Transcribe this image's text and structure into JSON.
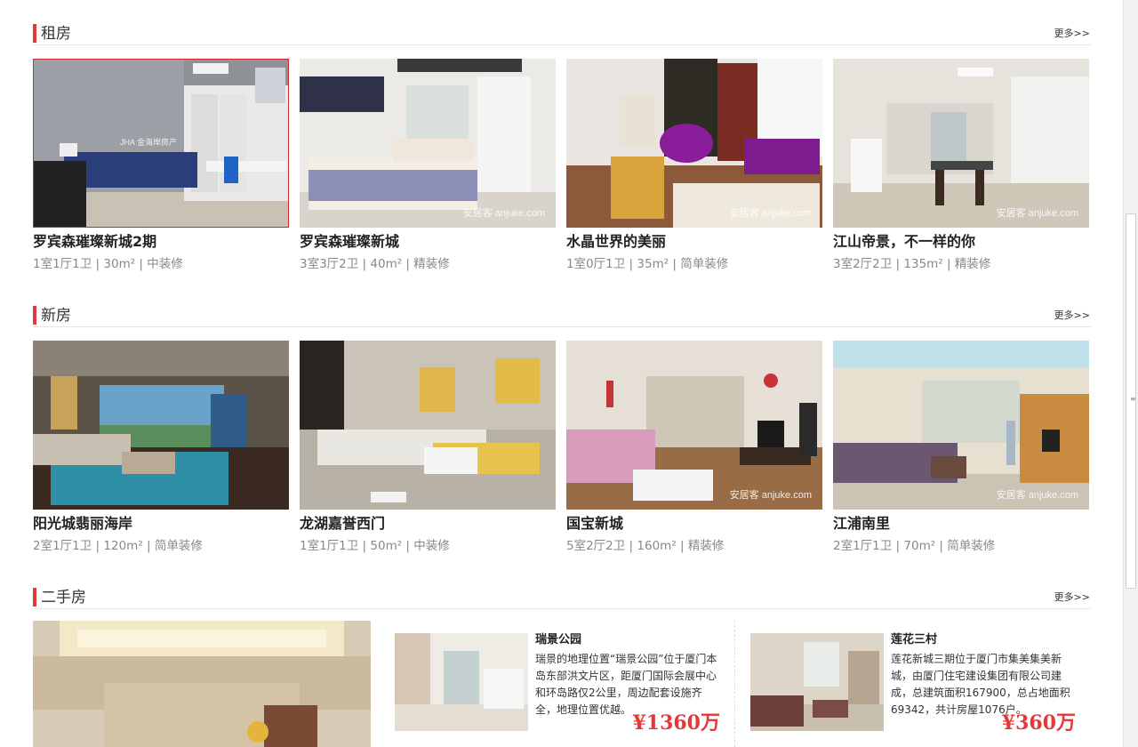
{
  "rent": {
    "title": "租房",
    "more": "更多>>",
    "items": [
      {
        "name": "罗宾森璀璨新城2期",
        "meta": "1室1厅1卫 | 30m² | 中装修",
        "watermark": "JHA 金海岸房产"
      },
      {
        "name": "罗宾森璀璨新城",
        "meta": "3室3厅2卫 | 40m² | 精装修",
        "watermark": "安居客 anjuke.com"
      },
      {
        "name": "水晶世界的美丽",
        "meta": "1室0厅1卫 | 35m² | 简单装修",
        "watermark": "安居客 anjuke.com"
      },
      {
        "name": "江山帝景，不一样的你",
        "meta": "3室2厅2卫 | 135m² | 精装修",
        "watermark": "安居客 anjuke.com"
      }
    ]
  },
  "new": {
    "title": "新房",
    "more": "更多>>",
    "items": [
      {
        "name": "阳光城翡丽海岸",
        "meta": "2室1厅1卫 | 120m² | 简单装修",
        "watermark": ""
      },
      {
        "name": "龙湖嘉誉西门",
        "meta": "1室1厅1卫 | 50m² | 中装修",
        "watermark": ""
      },
      {
        "name": "国宝新城",
        "meta": "5室2厅2卫 | 160m² | 精装修",
        "watermark": "安居客 anjuke.com"
      },
      {
        "name": "江浦南里",
        "meta": "2室1厅1卫 | 70m² | 简单装修",
        "watermark": "安居客 anjuke.com"
      }
    ]
  },
  "secondhand": {
    "title": "二手房",
    "more": "更多>>",
    "listings": [
      {
        "title": "瑞景公园",
        "desc": "瑞景的地理位置“瑞景公园”位于厦门本岛东部洪文片区，距厦门国际会展中心和环岛路仅2公里，周边配套设施齐全，地理位置优越。",
        "price": "¥1360万"
      },
      {
        "title": "莲花三村",
        "desc": "莲花新城三期位于厦门市集美集美新城，由厦门住宅建设集团有限公司建成，总建筑面积167900，总占地面积69342，共计房屋1076户。",
        "price": "¥360万"
      }
    ]
  },
  "colors": {
    "accent": "#e4393c",
    "price": "#e4393c",
    "selected_border": "#d9262d"
  }
}
